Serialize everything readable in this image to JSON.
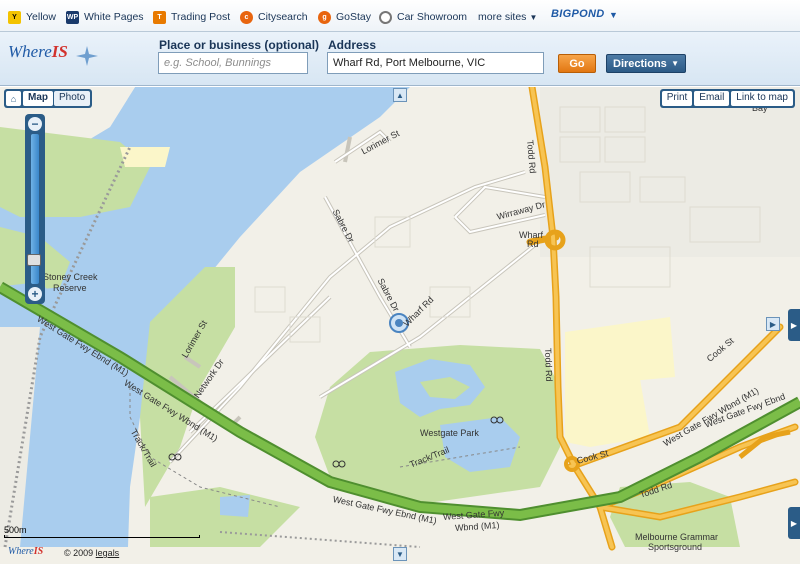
{
  "sitebar": {
    "links": [
      {
        "label": "Yellow",
        "icon": "yellow-pages-icon",
        "color": "#f3c300"
      },
      {
        "label": "White Pages",
        "icon": "white-pages-icon",
        "color": "#1a3a6b"
      },
      {
        "label": "Trading Post",
        "icon": "trading-post-icon",
        "color": "#e87a00"
      },
      {
        "label": "Citysearch",
        "icon": "citysearch-icon",
        "color": "#e8650f"
      },
      {
        "label": "GoStay",
        "icon": "gostay-icon",
        "color": "#e8650f"
      },
      {
        "label": "Car Showroom",
        "icon": "car-showroom-icon",
        "color": "#777777"
      }
    ],
    "more_sites": "more sites",
    "bigpond": "BIGPOND"
  },
  "header": {
    "logo_where": "Where",
    "logo_is": "IS",
    "place_label": "Place or business (optional)",
    "place_placeholder": "e.g. School, Bunnings",
    "address_label": "Address",
    "address_value": "Wharf Rd, Port Melbourne, VIC",
    "go_label": "Go",
    "directions_label": "Directions"
  },
  "map": {
    "tabs": {
      "map": "Map",
      "photo": "Photo"
    },
    "tools": {
      "print": "Print",
      "email": "Email",
      "link": "Link to map"
    },
    "scale_label": "500m",
    "labels": {
      "lorimer_st_top": "Lorimer St",
      "sabre_dr": "Sabre Dr",
      "sabre_dr_2": "Sabre Dr",
      "wharf_rd_diag": "Wharf Rd",
      "wharf_rd_top": "Wharf",
      "wharf_rd_top2": "Rd",
      "wirraway_dr": "Wirraway Dr",
      "todd_rd_top": "Todd Rd",
      "todd_rd_mid": "Todd Rd",
      "todd_rd_bottom": "Todd Rd",
      "lorimer_st_left": "Lorimer St",
      "network_dr": "Network Dr",
      "stoney_creek": "Stoney Creek",
      "stoney_reserve": "Reserve",
      "westgate_ebnd_left": "West Gate Fwy Ebnd (M1)",
      "westgate_wbnd_left": "West Gate Fwy Wbnd (M1)",
      "westgate_ebnd_mid": "West Gate Fwy Ebnd (M1)",
      "westgate_wbnd_mid": "West Gate Fwy",
      "westgate_wbnd_mid2": "Wbnd (M1)",
      "westgate_park": "Westgate Park",
      "track_trail_left": "Track/Trail",
      "track_trail_mid": "Track/Trail",
      "cook_st_right": "Cook St",
      "cook_st_bottom": "Cook St",
      "westgate_wbnd_right": "West Gate Fwy Wbnd (M1)",
      "westgate_ebnd_right": "West Gate Fwy Ebnd",
      "melbourne_grammar": "Melbourne Grammar",
      "sportsground": "Sportsground",
      "bay_label": "Bay"
    }
  },
  "footer": {
    "logo_where": "Where",
    "logo_is": "IS",
    "copyright": "© 2009",
    "legals": "legals"
  }
}
